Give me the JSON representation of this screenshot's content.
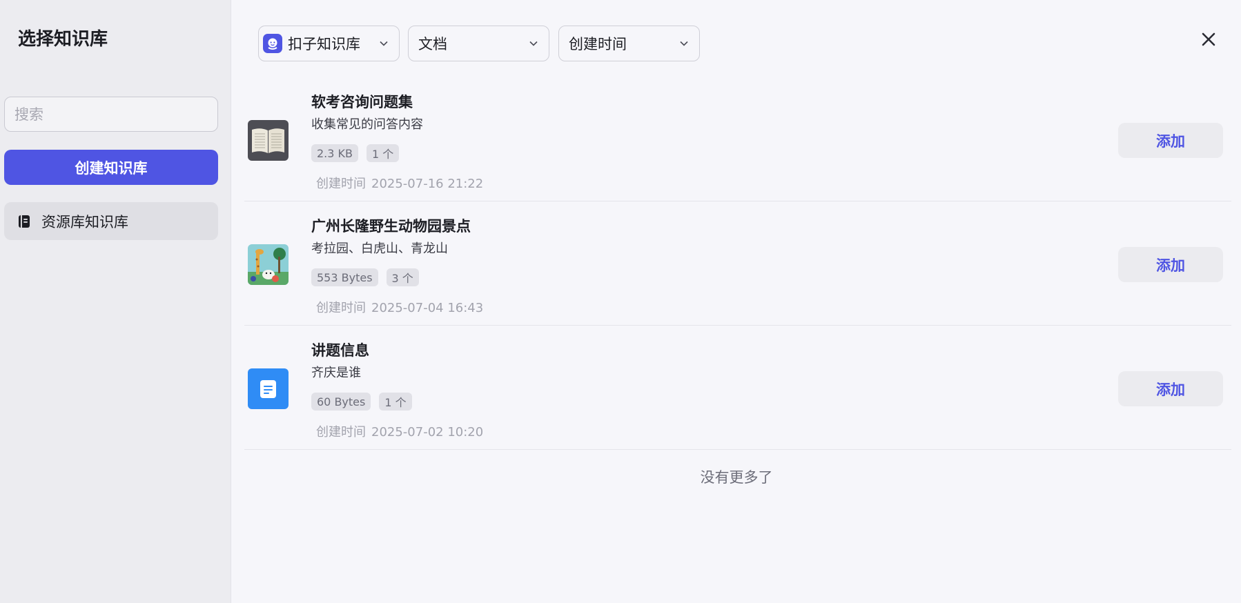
{
  "sidebar": {
    "title": "选择知识库",
    "search_placeholder": "搜索",
    "create_label": "创建知识库",
    "nav_item": "资源库知识库"
  },
  "filters": {
    "source": "扣子知识库",
    "type": "文档",
    "sort": "创建时间"
  },
  "items": [
    {
      "title": "软考咨询问题集",
      "desc": "收集常见的问答内容",
      "size": "2.3 KB",
      "count": "1 个",
      "created_label": "创建时间",
      "created_time": "2025-07-16 21:22",
      "add_label": "添加",
      "thumb_icon": "open-book-thumbnail"
    },
    {
      "title": "广州长隆野生动物园景点",
      "desc": "考拉园、白虎山、青龙山",
      "size": "553 Bytes",
      "count": "3 个",
      "created_label": "创建时间",
      "created_time": "2025-07-04 16:43",
      "add_label": "添加",
      "thumb_icon": "zoo-illustration-thumbnail"
    },
    {
      "title": "讲题信息",
      "desc": "齐庆是谁",
      "size": "60 Bytes",
      "count": "1 个",
      "created_label": "创建时间",
      "created_time": "2025-07-02 10:20",
      "add_label": "添加",
      "thumb_icon": "document-icon"
    }
  ],
  "footer": {
    "no_more": "没有更多了"
  },
  "colors": {
    "accent": "#4f55e3",
    "doc_blue": "#2f8cf5"
  }
}
